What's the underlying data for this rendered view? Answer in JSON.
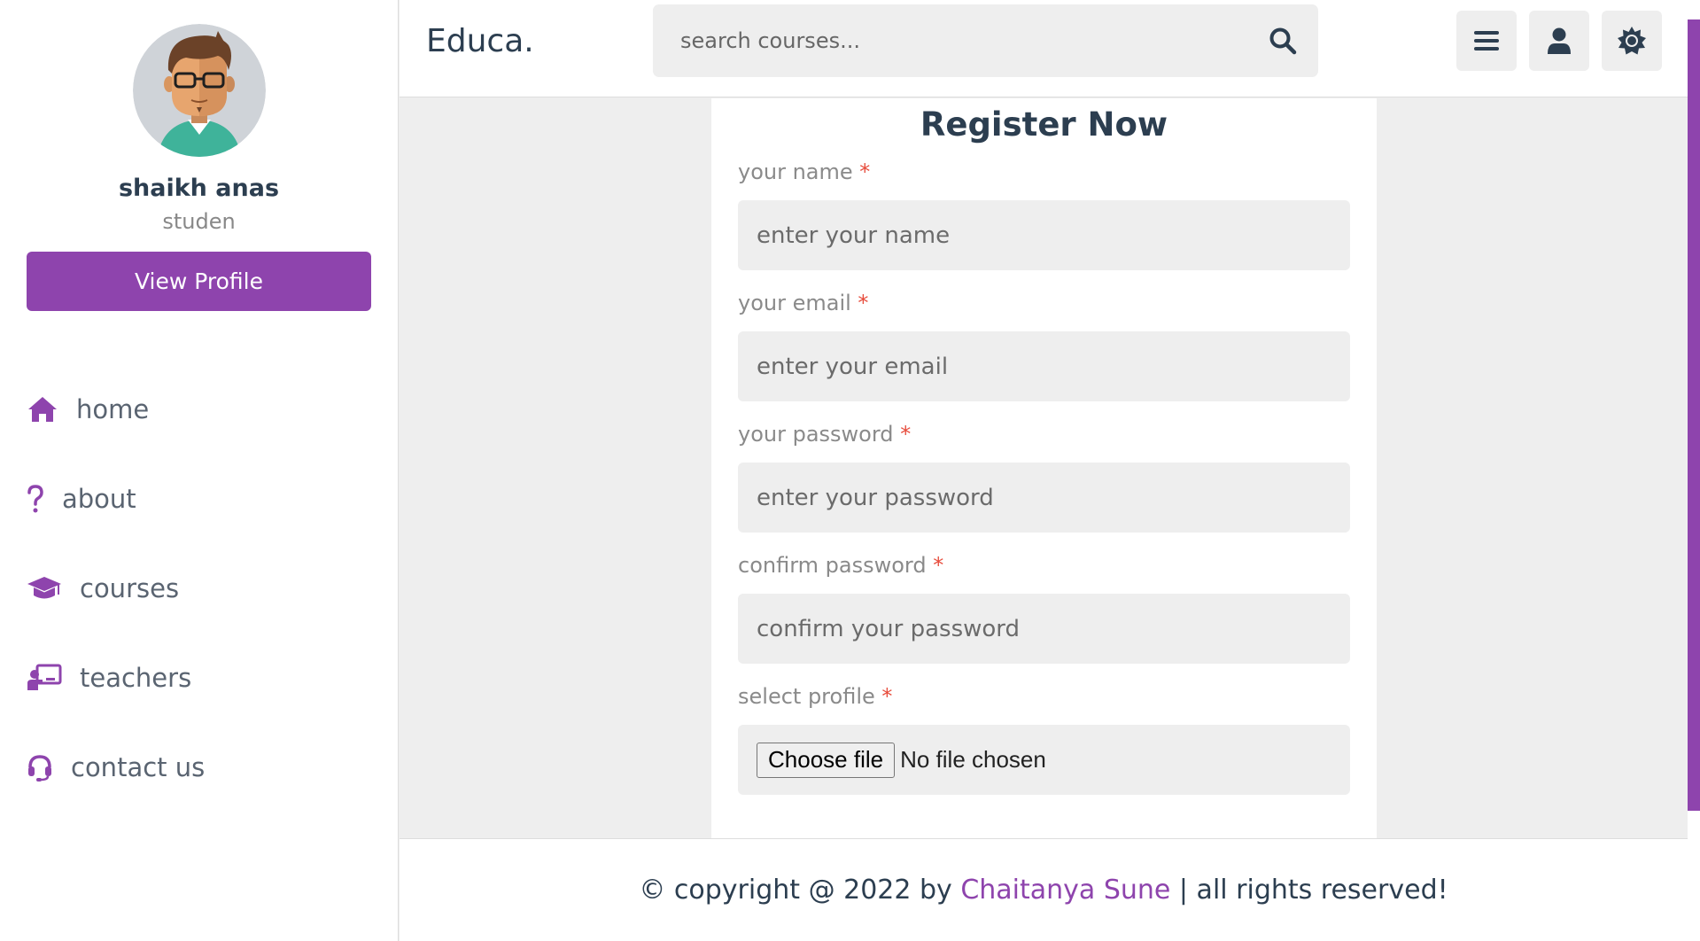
{
  "colors": {
    "main": "#8e44ad",
    "text": "#2c3e50",
    "light_bg": "#eeeeee"
  },
  "sidebar": {
    "profile": {
      "avatar_icon": "avatar-icon",
      "name": "shaikh anas",
      "role": "studen",
      "button_label": "View Profile"
    },
    "items": [
      {
        "label": "home",
        "icon": "home-icon"
      },
      {
        "label": "about",
        "icon": "question-icon"
      },
      {
        "label": "courses",
        "icon": "graduation-cap-icon"
      },
      {
        "label": "teachers",
        "icon": "chalkboard-teacher-icon"
      },
      {
        "label": "contact us",
        "icon": "headset-icon"
      }
    ]
  },
  "header": {
    "logo": "Educa.",
    "search": {
      "placeholder": "search courses...",
      "icon": "search-icon"
    },
    "buttons": [
      {
        "icon": "menu-icon"
      },
      {
        "icon": "user-icon"
      },
      {
        "icon": "sun-icon"
      }
    ]
  },
  "form": {
    "title": "Register Now",
    "required_mark": "*",
    "fields": [
      {
        "label": "your name",
        "placeholder": "enter your name"
      },
      {
        "label": "your email",
        "placeholder": "enter your email"
      },
      {
        "label": "your password",
        "placeholder": "enter your password"
      },
      {
        "label": "confirm password",
        "placeholder": "confirm your password"
      }
    ],
    "file_field": {
      "label": "select profile",
      "button_label": "Choose file",
      "status": "No file chosen"
    }
  },
  "footer": {
    "prefix": "© copyright @ 2022 by ",
    "author": "Chaitanya Sune",
    "suffix": " | all rights reserved!"
  }
}
